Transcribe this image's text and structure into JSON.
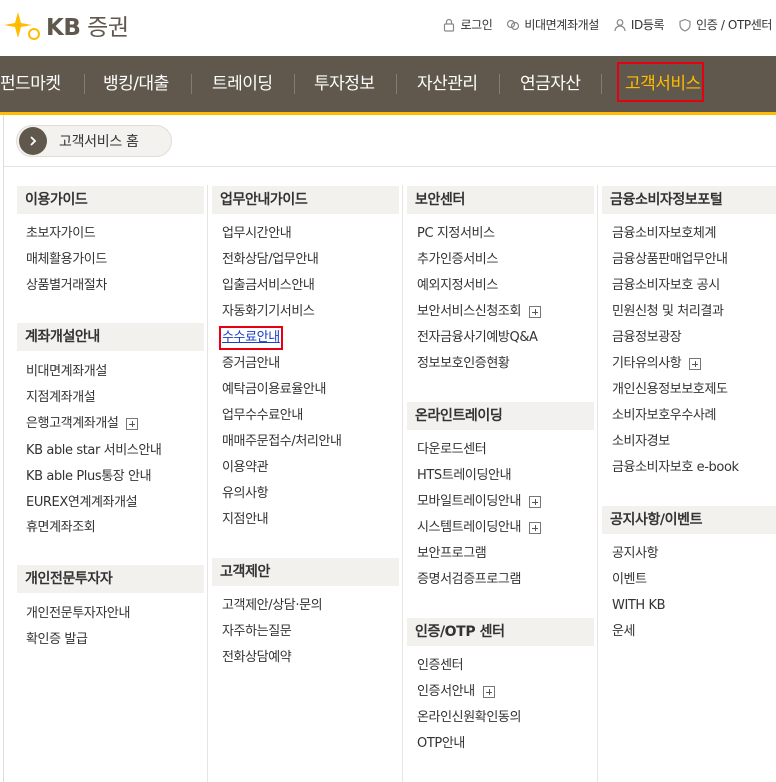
{
  "header": {
    "logo_brand": "KB",
    "logo_name": "증권",
    "util": [
      {
        "label": "로그인",
        "icon": "lock-icon"
      },
      {
        "label": "비대면계좌개설",
        "icon": "link-icon"
      },
      {
        "label": "ID등록",
        "icon": "person-icon"
      },
      {
        "label": "인증 / OTP센터",
        "icon": "shield-icon"
      }
    ]
  },
  "gnb": {
    "items": [
      "펀드마켓",
      "뱅킹/대출",
      "트레이딩",
      "투자정보",
      "자산관리",
      "연금자산",
      "고객서비스"
    ],
    "active": "고객서비스"
  },
  "panel": {
    "home_label": "고객서비스 홈",
    "columns": [
      {
        "sections": [
          {
            "title": "이용가이드",
            "items": [
              {
                "label": "초보자가이드"
              },
              {
                "label": "매체활용가이드"
              },
              {
                "label": "상품별거래절차"
              }
            ]
          },
          {
            "title": "계좌개설안내",
            "items": [
              {
                "label": "비대면계좌개설"
              },
              {
                "label": "지점계좌개설"
              },
              {
                "label": "은행고객계좌개설",
                "plus": true
              },
              {
                "label": "KB able star 서비스안내"
              },
              {
                "label": "KB able Plus통장 안내"
              },
              {
                "label": "EUREX연계계좌개설"
              },
              {
                "label": "휴면계좌조회"
              }
            ]
          },
          {
            "title": "개인전문투자자",
            "items": [
              {
                "label": "개인전문투자자안내"
              },
              {
                "label": "확인증 발급"
              }
            ]
          }
        ]
      },
      {
        "sections": [
          {
            "title": "업무안내가이드",
            "items": [
              {
                "label": "업무시간안내"
              },
              {
                "label": "전화상담/업무안내"
              },
              {
                "label": "입출금서비스안내"
              },
              {
                "label": "자동화기기서비스"
              },
              {
                "label": "수수료안내",
                "selected": true
              },
              {
                "label": "증거금안내"
              },
              {
                "label": "예탁금이용료율안내"
              },
              {
                "label": "업무수수료안내"
              },
              {
                "label": "매매주문접수/처리안내"
              },
              {
                "label": "이용약관"
              },
              {
                "label": "유의사항"
              },
              {
                "label": "지점안내"
              }
            ]
          },
          {
            "title": "고객제안",
            "items": [
              {
                "label": "고객제안/상담·문의"
              },
              {
                "label": "자주하는질문"
              },
              {
                "label": "전화상담예약"
              }
            ]
          }
        ]
      },
      {
        "sections": [
          {
            "title": "보안센터",
            "items": [
              {
                "label": "PC 지정서비스"
              },
              {
                "label": "추가인증서비스"
              },
              {
                "label": "예외지정서비스"
              },
              {
                "label": "보안서비스신청조회",
                "plus": true
              },
              {
                "label": "전자금융사기예방Q&A"
              },
              {
                "label": "정보보호인증현황"
              }
            ]
          },
          {
            "title": "온라인트레이딩",
            "items": [
              {
                "label": "다운로드센터"
              },
              {
                "label": "HTS트레이딩안내"
              },
              {
                "label": "모바일트레이딩안내",
                "plus": true
              },
              {
                "label": "시스템트레이딩안내",
                "plus": true
              },
              {
                "label": "보안프로그램"
              },
              {
                "label": "증명서검증프로그램"
              }
            ]
          },
          {
            "title": "인증/OTP 센터",
            "items": [
              {
                "label": "인증센터"
              },
              {
                "label": "인증서안내",
                "plus": true
              },
              {
                "label": "온라인신원확인동의"
              },
              {
                "label": "OTP안내"
              }
            ]
          }
        ]
      },
      {
        "sections": [
          {
            "title": "금융소비자정보포털",
            "items": [
              {
                "label": "금융소비자보호체계"
              },
              {
                "label": "금융상품판매업무안내"
              },
              {
                "label": "금융소비자보호 공시"
              },
              {
                "label": "민원신청 및 처리결과"
              },
              {
                "label": "금융정보광장"
              },
              {
                "label": "기타유의사항",
                "plus": true
              },
              {
                "label": "개인신용정보보호제도"
              },
              {
                "label": "소비자보호우수사례"
              },
              {
                "label": "소비자경보"
              },
              {
                "label": "금융소비자보호 e-book"
              }
            ]
          },
          {
            "title": "공지사항/이벤트",
            "items": [
              {
                "label": "공지사항"
              },
              {
                "label": "이벤트"
              },
              {
                "label": "WITH KB"
              },
              {
                "label": "운세"
              }
            ]
          }
        ]
      }
    ]
  }
}
